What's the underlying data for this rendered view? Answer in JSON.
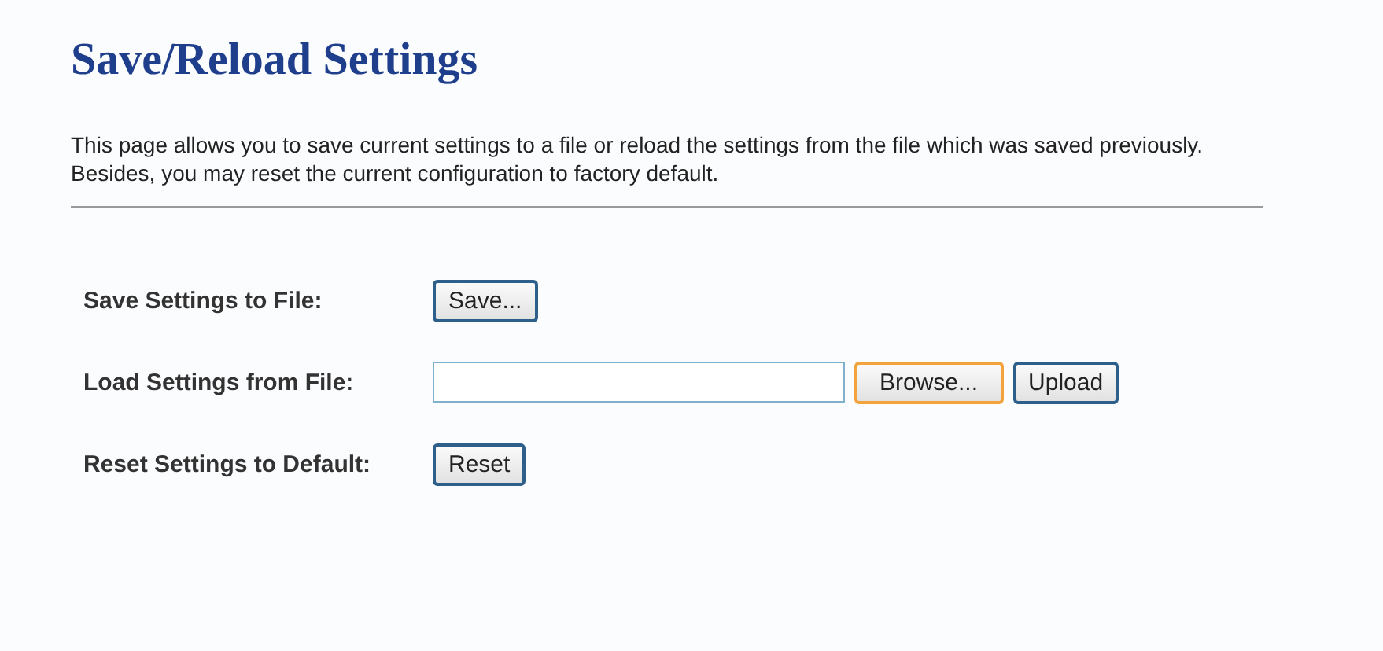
{
  "title": "Save/Reload Settings",
  "description": "This page allows you to save current settings to a file or reload the settings from the file which was saved previously. Besides, you may reset the current configuration to factory default.",
  "rows": [
    {
      "label": "Save Settings to File:",
      "has_file_field": false,
      "buttons": [
        {
          "label": "Save...",
          "highlighted": false
        }
      ]
    },
    {
      "label": "Load Settings from File:",
      "has_file_field": true,
      "buttons": [
        {
          "label": "Browse...",
          "highlighted": true
        },
        {
          "label": "Upload",
          "highlighted": false
        }
      ]
    },
    {
      "label": "Reset Settings to Default:",
      "has_file_field": false,
      "buttons": [
        {
          "label": "Reset",
          "highlighted": false
        }
      ]
    }
  ]
}
